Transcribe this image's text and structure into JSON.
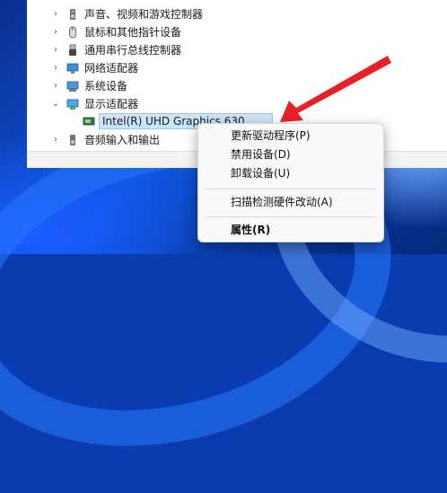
{
  "tree": {
    "items": [
      {
        "label": "声音、视频和游戏控制器",
        "icon": "speaker-icon"
      },
      {
        "label": "鼠标和其他指针设备",
        "icon": "mouse-icon"
      },
      {
        "label": "通用串行总线控制器",
        "icon": "usb-icon"
      },
      {
        "label": "网络适配器",
        "icon": "network-adapter-icon"
      },
      {
        "label": "系统设备",
        "icon": "system-device-icon"
      },
      {
        "label": "显示适配器",
        "icon": "display-adapter-icon"
      },
      {
        "label": "Intel(R) UHD Graphics 630",
        "icon": "gpu-icon"
      },
      {
        "label": "音频输入和输出",
        "icon": "audio-io-icon"
      }
    ]
  },
  "context_menu": {
    "items": [
      {
        "label": "更新驱动程序(P)"
      },
      {
        "label": "禁用设备(D)"
      },
      {
        "label": "卸载设备(U)"
      },
      {
        "label": "扫描检测硬件改动(A)"
      },
      {
        "label": "属性(R)"
      }
    ]
  },
  "colors": {
    "selection": "#cce4f7",
    "annotation_arrow": "#e8202a"
  }
}
